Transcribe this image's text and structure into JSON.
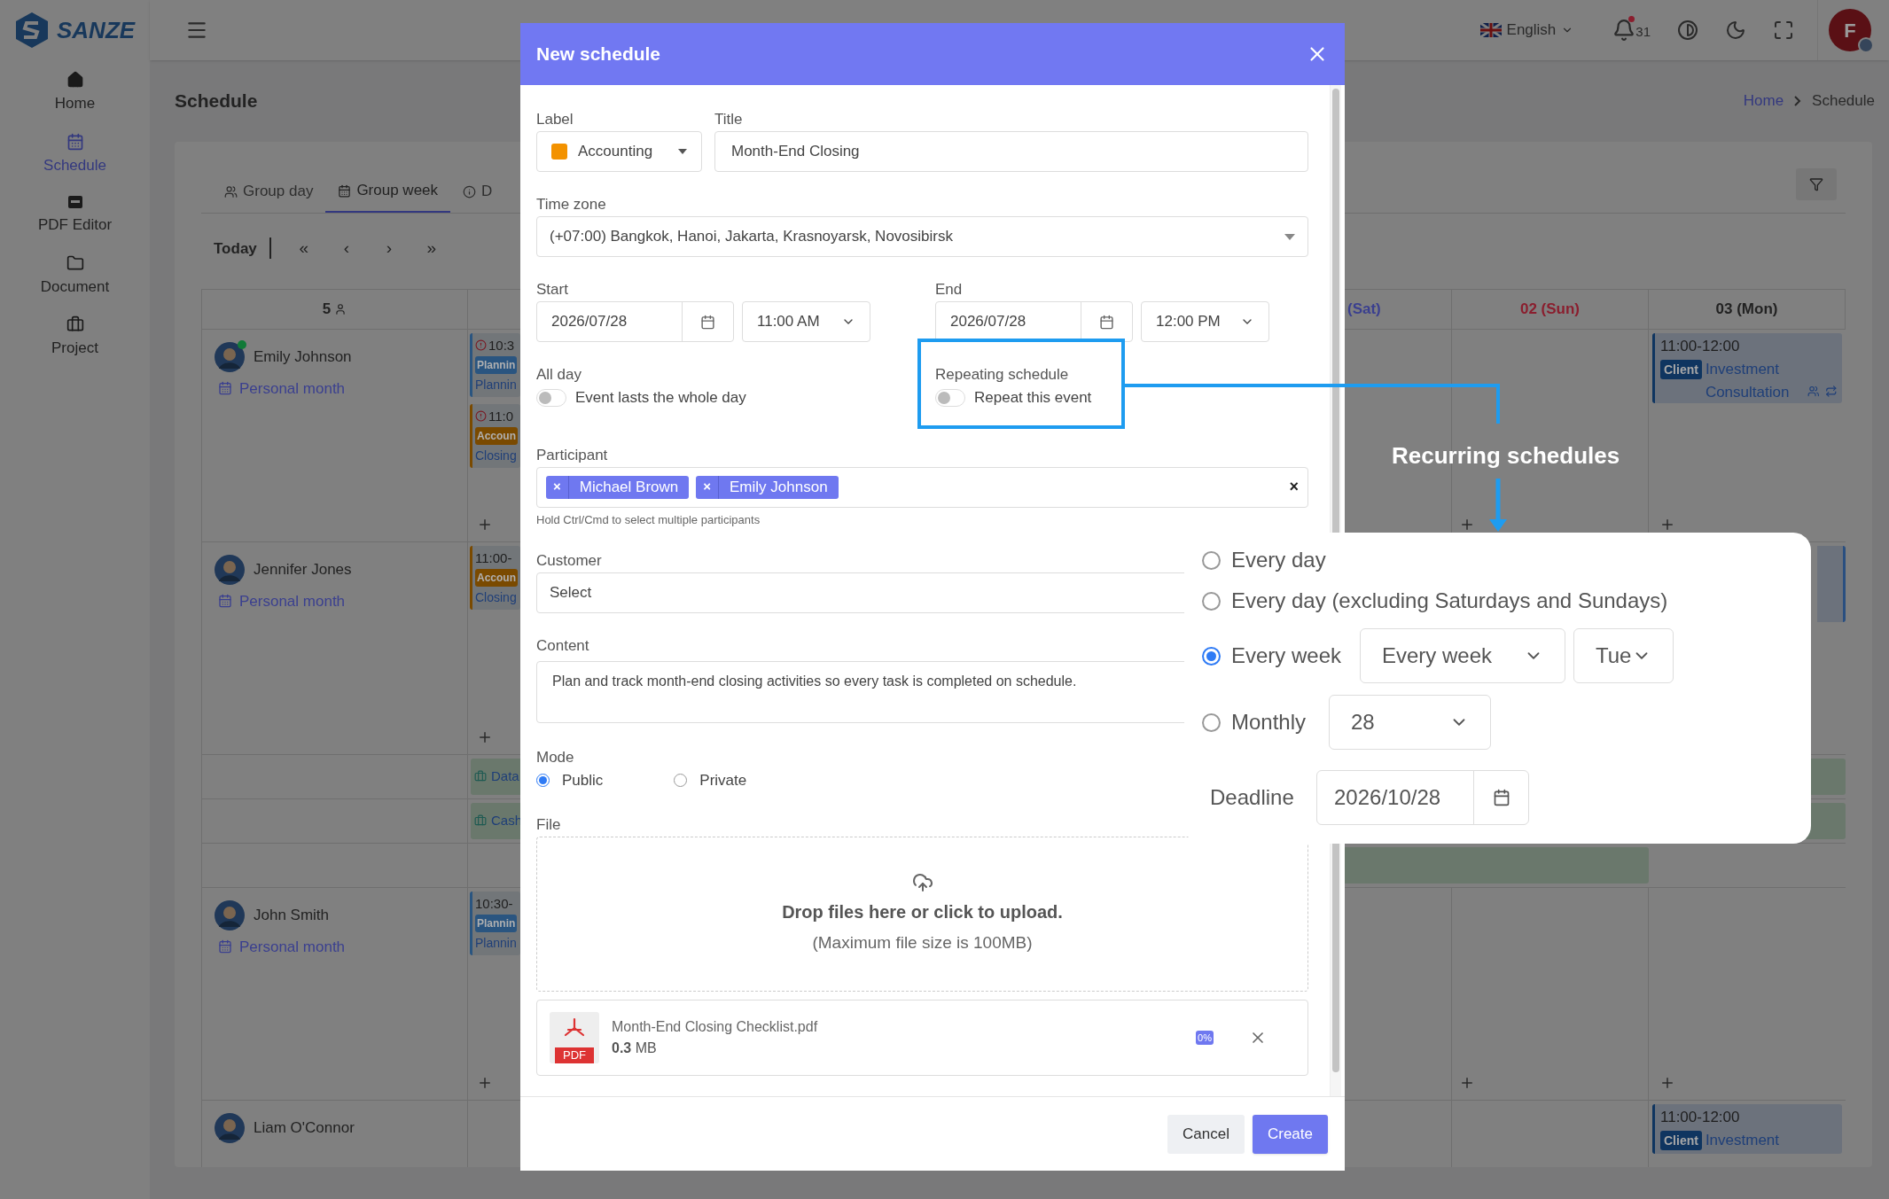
{
  "brand": {
    "name": "SANZE"
  },
  "sidebar": [
    {
      "label": "Home",
      "selected": false
    },
    {
      "label": "Schedule",
      "selected": true
    },
    {
      "label": "PDF Editor",
      "selected": false
    },
    {
      "label": "Document",
      "selected": false
    },
    {
      "label": "Project",
      "selected": false
    }
  ],
  "topbar": {
    "language": "English",
    "notification_count": "31",
    "unread": true,
    "avatar_initial": "F"
  },
  "page": {
    "title": "Schedule",
    "breadcrumb": [
      {
        "label": "Home",
        "link": true
      },
      {
        "label": "Schedule",
        "link": false
      }
    ]
  },
  "tabs": [
    {
      "label": "Group day",
      "selected": false
    },
    {
      "label": "Group week",
      "selected": true
    },
    {
      "label": "D",
      "selected": false
    }
  ],
  "toolbar": {
    "today": "Today",
    "nav": [
      "«",
      "‹",
      "›",
      "»"
    ]
  },
  "calendar": {
    "member_count": "5",
    "day_headers": [
      {
        "label": "(Sat)",
        "kind": "saturday"
      },
      {
        "label": "02 (Sun)",
        "kind": "sunday"
      },
      {
        "label": "03 (Mon)",
        "kind": "weekday"
      }
    ],
    "rows": [
      {
        "kind": "member",
        "name": "Emily Johnson",
        "online": true,
        "link": "Personal month",
        "add_right": true,
        "first_column": [
          {
            "kind": "event",
            "time": "10:3",
            "alert": true,
            "tag": "Plannin",
            "title": "Plannin",
            "color": "#2a5580"
          },
          {
            "kind": "event",
            "time": "11:0",
            "alert": true,
            "tag": "Accoun",
            "title": "Closing",
            "color": "#7a4a00"
          }
        ],
        "last_column": [
          {
            "kind": "event",
            "time": "11:00-12:00",
            "tag": "Client",
            "title": "Investment Consultation",
            "participants": true,
            "repeat": true,
            "color": "#0f3560"
          }
        ]
      },
      {
        "kind": "member",
        "name": "Jennifer Jones",
        "online": false,
        "link": "Personal month",
        "add_right": false,
        "first_column": [
          {
            "kind": "event",
            "time": "11:00-",
            "alert": false,
            "tag": "Accoun",
            "title": "Closing",
            "color": "#7a4a00"
          }
        ],
        "last_column": [
          {
            "kind": "covered",
            "color": "#2a4f80"
          }
        ]
      },
      {
        "kind": "project",
        "label": "Data"
      },
      {
        "kind": "project",
        "label": "Cash"
      },
      {
        "kind": "project_partial"
      },
      {
        "kind": "member",
        "name": "John Smith",
        "online": false,
        "link": "Personal month",
        "add_right": true,
        "first_column": [
          {
            "kind": "event",
            "time": "10:30-",
            "alert": false,
            "tag": "Plannin",
            "title": "Plannin",
            "color": "#2a5580"
          }
        ]
      },
      {
        "kind": "member",
        "name": "Liam O'Connor",
        "online": false,
        "add_right": false,
        "last_column": [
          {
            "kind": "event",
            "time": "11:00-12:00",
            "tag": "Client",
            "title": "Investment",
            "color": "#0f3560"
          }
        ]
      }
    ]
  },
  "dialog": {
    "title": "New schedule",
    "label": {
      "caption": "Label",
      "value": "Accounting",
      "color": "#f39200"
    },
    "title_field": {
      "caption": "Title",
      "value": "Month-End Closing"
    },
    "time_zone": {
      "caption": "Time zone",
      "value": "(+07:00) Bangkok, Hanoi, Jakarta, Krasnoyarsk, Novosibirsk"
    },
    "start": {
      "caption": "Start",
      "date": "2026/07/28",
      "time": "11:00 AM"
    },
    "end": {
      "caption": "End",
      "date": "2026/07/28",
      "time": "12:00 PM"
    },
    "all_day": {
      "caption": "All day",
      "text": "Event lasts the whole day",
      "on": false
    },
    "repeating": {
      "caption": "Repeating schedule",
      "text": "Repeat this event",
      "on": false
    },
    "participant": {
      "caption": "Participant",
      "chips": [
        "Michael Brown",
        "Emily Johnson"
      ],
      "remove_mark": "×",
      "clear_mark": "×",
      "hint": "Hold Ctrl/Cmd to select multiple participants"
    },
    "customer": {
      "caption": "Customer",
      "placeholder": "Select"
    },
    "content": {
      "caption": "Content",
      "value": "Plan and track month-end closing activities so every task is completed on schedule."
    },
    "mode": {
      "caption": "Mode",
      "options": [
        {
          "label": "Public",
          "selected": true
        },
        {
          "label": "Private",
          "selected": false
        }
      ]
    },
    "file": {
      "caption": "File",
      "drop_text": "Drop files here or click to upload.",
      "limit": "(Maximum file size is 100MB)",
      "item": {
        "type": "PDF",
        "name": "Month-End Closing Checklist.pdf",
        "size": "**0.3** MB",
        "progress": "0%"
      }
    },
    "buttons": {
      "cancel": "Cancel",
      "create": "Create"
    }
  },
  "repeat_panel": {
    "options": [
      {
        "kind": "plain",
        "label": "Every day",
        "selected": false
      },
      {
        "kind": "plain",
        "label": "Every day (excluding Saturdays and Sundays)",
        "selected": false
      },
      {
        "kind": "weekly",
        "label": "Every week",
        "selected": true,
        "interval": "Every week",
        "weekday": "Tue"
      },
      {
        "kind": "monthly",
        "label": "Monthly",
        "selected": false,
        "day": "28"
      }
    ],
    "deadline": {
      "caption": "Deadline",
      "value": "2026/10/28"
    }
  },
  "callout": {
    "text": "Recurring schedules"
  }
}
